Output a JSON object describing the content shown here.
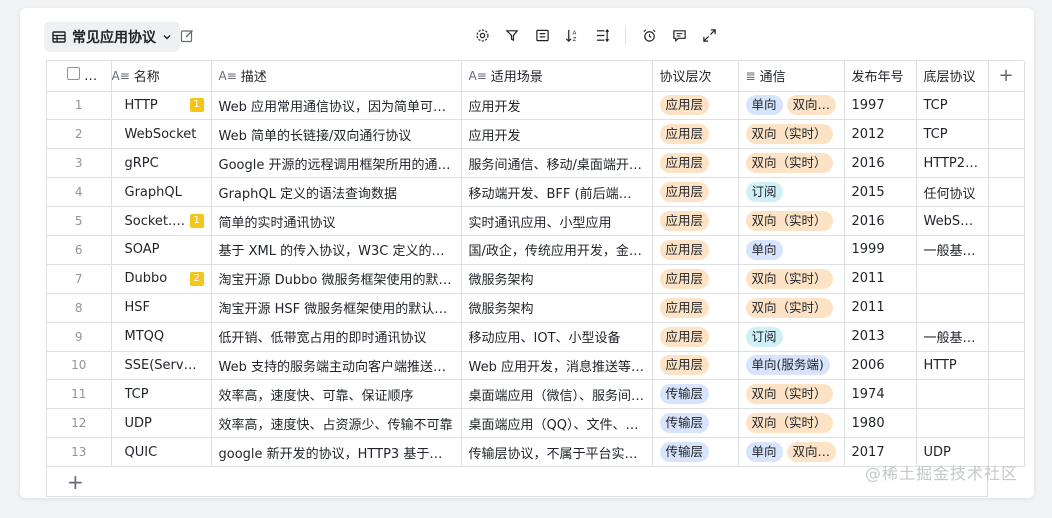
{
  "view": {
    "title": "常见应用协议"
  },
  "columns": {
    "name": "名称",
    "desc": "描述",
    "scene": "适用场景",
    "layer": "协议层次",
    "comm": "通信",
    "year": "发布年号",
    "base": "底层协议"
  },
  "rows": [
    {
      "num": "1",
      "name": "HTTP",
      "badge": "1",
      "desc": "Web 应用常用通信协议，因为简单可靠…",
      "scene": "应用开发",
      "layer": "应用层",
      "comm": [
        "单向",
        "双向…"
      ],
      "year": "1997",
      "base": "TCP"
    },
    {
      "num": "2",
      "name": "WebSocket",
      "badge": "",
      "desc": "Web 简单的长链接/双向通行协议",
      "scene": "应用开发",
      "layer": "应用层",
      "comm": [
        "双向（实时）"
      ],
      "year": "2012",
      "base": "TCP"
    },
    {
      "num": "3",
      "name": "gRPC",
      "badge": "",
      "desc": "Google 开源的远程调用框架所用的通信…",
      "scene": "服务间通信、移动/桌面端开…",
      "layer": "应用层",
      "comm": [
        "双向（实时）"
      ],
      "year": "2016",
      "base": "HTTP2…"
    },
    {
      "num": "4",
      "name": "GraphQL",
      "badge": "",
      "desc": "GraphQL 定义的语法查询数据",
      "scene": "移动端开发、BFF (前后端中…",
      "layer": "应用层",
      "comm": [
        "订阅"
      ],
      "year": "2015",
      "base": "任何协议"
    },
    {
      "num": "5",
      "name": "Socket.IO",
      "badge": "1",
      "desc": "简单的实时通讯协议",
      "scene": "实时通讯应用、小型应用",
      "layer": "应用层",
      "comm": [
        "双向（实时）"
      ],
      "year": "2016",
      "base": "WebSo…"
    },
    {
      "num": "6",
      "name": "SOAP",
      "badge": "",
      "desc": "基于 XML 的传入协议，W3C 定义的古…",
      "scene": "国/政企，传统应用开发，金…",
      "layer": "应用层",
      "comm": [
        "单向"
      ],
      "year": "1999",
      "base": "一般基…"
    },
    {
      "num": "7",
      "name": "Dubbo",
      "badge": "2",
      "desc": "淘宝开源 Dubbo 微服务框架使用的默认…",
      "scene": "微服务架构",
      "layer": "应用层",
      "comm": [
        "双向（实时）"
      ],
      "year": "2011",
      "base": ""
    },
    {
      "num": "8",
      "name": "HSF",
      "badge": "",
      "desc": "淘宝开源 HSF 微服务框架使用的默认协议",
      "scene": "微服务架构",
      "layer": "应用层",
      "comm": [
        "双向（实时）"
      ],
      "year": "2011",
      "base": ""
    },
    {
      "num": "9",
      "name": "MTQQ",
      "badge": "",
      "desc": "低开销、低带宽占用的即时通讯协议",
      "scene": "移动应用、IOT、小型设备",
      "layer": "应用层",
      "comm": [
        "订阅"
      ],
      "year": "2013",
      "base": "一般基…"
    },
    {
      "num": "10",
      "name": "SSE(Server-…",
      "badge": "",
      "desc": "Web 支持的服务端主动向客户端推送的…",
      "scene": "Web 应用开发，消息推送等…",
      "layer": "应用层",
      "comm": [
        "单向(服务端)"
      ],
      "year": "2006",
      "base": "HTTP"
    },
    {
      "num": "11",
      "name": "TCP",
      "badge": "",
      "desc": "效率高，速度快、可靠、保证顺序",
      "scene": "桌面端应用（微信）、服务间…",
      "layer": "传输层",
      "comm": [
        "双向（实时）"
      ],
      "year": "1974",
      "base": ""
    },
    {
      "num": "12",
      "name": "UDP",
      "badge": "",
      "desc": "效率高，速度快、占资源少、传输不可靠",
      "scene": "桌面端应用（QQ）、文件、…",
      "layer": "传输层",
      "comm": [
        "双向（实时）"
      ],
      "year": "1980",
      "base": ""
    },
    {
      "num": "13",
      "name": "QUIC",
      "badge": "",
      "desc": "google 新开发的协议，HTTP3 基于它…",
      "scene": "传输层协议，不属于平台实现…",
      "layer": "传输层",
      "comm": [
        "单向",
        "双向…"
      ],
      "year": "2017",
      "base": "UDP"
    }
  ],
  "colors": {
    "应用层": "#fde3c6",
    "传输层": "#d7e4fb",
    "单向": "#d7e4fb",
    "单向(服务端)": "#d7e4fb",
    "双向": "#fde3c6",
    "订阅": "#d0f0f7"
  },
  "watermark": "@稀土掘金技术社区",
  "add_row_label": "+",
  "add_col_label": "+"
}
